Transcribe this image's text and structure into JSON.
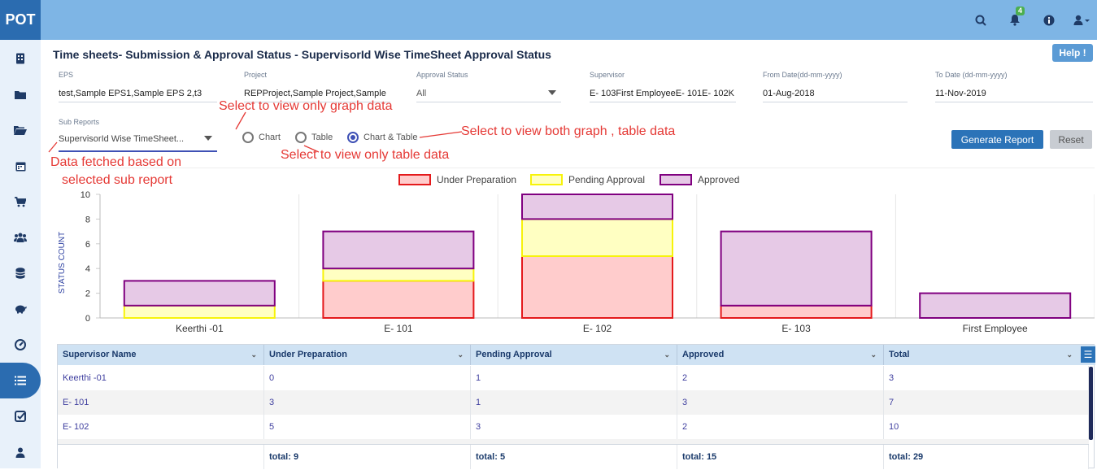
{
  "app": {
    "logo": "POT",
    "notification_count": "4"
  },
  "page": {
    "title": "Time sheets- Submission & Approval Status - SupervisorId Wise TimeSheet Approval Status",
    "help_label": "Help !"
  },
  "filters": {
    "eps": {
      "label": "EPS",
      "value": "test,Sample EPS1,Sample EPS 2,t3"
    },
    "project": {
      "label": "Project",
      "value": "REPProject,Sample Project,Sample"
    },
    "approval_status": {
      "label": "Approval Status",
      "value": "All"
    },
    "supervisor": {
      "label": "Supervisor",
      "value": "E- 103First EmployeeE- 101E- 102K"
    },
    "from_date": {
      "label": "From Date(dd-mm-yyyy)",
      "value": "01-Aug-2018"
    },
    "to_date": {
      "label": "To Date (dd-mm-yyyy)",
      "value": "11-Nov-2019"
    },
    "sub_reports": {
      "label": "Sub Reports",
      "value": "SupervisorId Wise TimeSheet..."
    }
  },
  "view_options": {
    "chart": "Chart",
    "table": "Table",
    "chart_table": "Chart & Table",
    "selected": "chart_table"
  },
  "buttons": {
    "generate": "Generate Report",
    "reset": "Reset"
  },
  "annotations": {
    "graph_only": "Select to view only graph data",
    "both": "Select to view both graph , table data",
    "table_only": "Select to view only table data",
    "subreport_line1": "Data fetched based on",
    "subreport_line2": "selected sub report"
  },
  "colors": {
    "under_preparation": "#e41a1c",
    "pending_approval": "#f7f30a",
    "approved": "#800080"
  },
  "chart_data": {
    "type": "bar",
    "stacked": true,
    "categories": [
      "Keerthi -01",
      "E- 101",
      "E- 102",
      "E- 103",
      "First Employee"
    ],
    "series": [
      {
        "name": "Under Preparation",
        "values": [
          0,
          3,
          5,
          1,
          0
        ]
      },
      {
        "name": "Pending Approval",
        "values": [
          1,
          1,
          3,
          0,
          0
        ]
      },
      {
        "name": "Approved",
        "values": [
          2,
          3,
          2,
          6,
          2
        ]
      }
    ],
    "ylabel": "STATUS COUNT",
    "yticks": [
      "0",
      "2",
      "4",
      "6",
      "8",
      "10"
    ],
    "ylim": [
      0,
      10
    ],
    "legend_position": "top-center",
    "grid": true
  },
  "table": {
    "headers": [
      "Supervisor Name",
      "Under Preparation",
      "Pending Approval",
      "Approved",
      "Total"
    ],
    "rows": [
      [
        "Keerthi -01",
        "0",
        "1",
        "2",
        "3"
      ],
      [
        "E- 101",
        "3",
        "1",
        "3",
        "7"
      ],
      [
        "E- 102",
        "5",
        "3",
        "2",
        "10"
      ]
    ],
    "footer": [
      "",
      "total: 9",
      "total: 5",
      "total: 15",
      "total: 29"
    ]
  }
}
